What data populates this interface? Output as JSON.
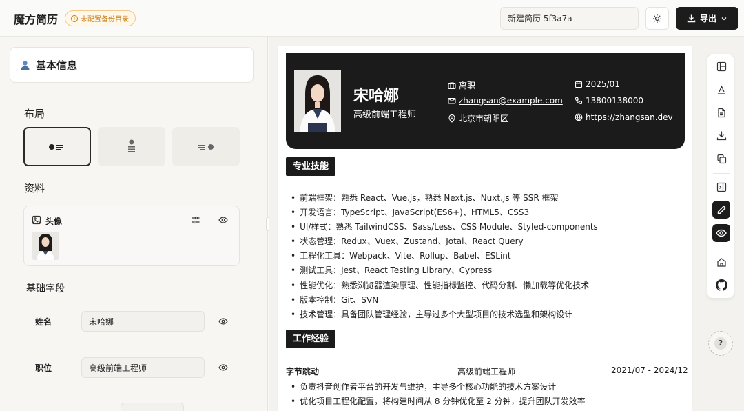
{
  "header": {
    "app_title": "魔方简历",
    "backup_badge": "未配置备份目录",
    "resume_name": "新建简历 5f3a7a",
    "export_label": "导出"
  },
  "left_panel": {
    "basic_info_label": "基本信息",
    "layout_title": "布局",
    "profile_title": "资料",
    "avatar_label": "头像",
    "basic_fields_title": "基础字段",
    "fields": [
      {
        "label": "姓名",
        "value": "宋哈娜"
      },
      {
        "label": "职位",
        "value": "高级前端工程师"
      }
    ]
  },
  "resume": {
    "name": "宋哈娜",
    "title": "高级前端工程师",
    "status": "离职",
    "date": "2025/01",
    "email": "zhangsan@example.com",
    "phone": "13800138000",
    "location": "北京市朝阳区",
    "website": "https://zhangsan.dev",
    "skills_title": "专业技能",
    "skills": [
      "前端框架：熟悉 React、Vue.js，熟悉 Next.js、Nuxt.js 等 SSR 框架",
      "开发语言：TypeScript、JavaScript(ES6+)、HTML5、CSS3",
      "UI/样式：熟悉 TailwindCSS、Sass/Less、CSS Module、Styled-components",
      "状态管理：Redux、Vuex、Zustand、Jotai、React Query",
      "工程化工具：Webpack、Vite、Rollup、Babel、ESLint",
      "测试工具：Jest、React Testing Library、Cypress",
      "性能优化：熟悉浏览器渲染原理、性能指标监控、代码分割、懒加载等优化技术",
      "版本控制：Git、SVN",
      "技术管理：具备团队管理经验，主导过多个大型项目的技术选型和架构设计"
    ],
    "work_title": "工作经验",
    "job": {
      "company": "字节跳动",
      "position": "高级前端工程师",
      "period": "2021/07 - 2024/12",
      "items": [
        "负责抖音创作者平台的开发与维护，主导多个核心功能的技术方案设计",
        "优化项目工程化配置，将构建时间从 8 分钟优化至 2 分钟，提升团队开发效率"
      ]
    }
  },
  "help_label": "?"
}
